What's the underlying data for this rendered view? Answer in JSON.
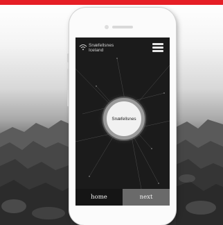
{
  "app": {
    "brand_line1": "Snæfellsnes",
    "brand_line2": "Iceland",
    "center_label": "Snæfellsnes"
  },
  "nav": {
    "home_label": "home",
    "next_label": "next"
  },
  "colors": {
    "accent_bar": "#e61f26",
    "screen_bg": "#1b1b1b",
    "nav_home": "#151515",
    "nav_next": "#6a6a6a"
  },
  "icons": {
    "brand_icon": "wifi-icon",
    "menu_icon": "hamburger-menu-icon"
  }
}
